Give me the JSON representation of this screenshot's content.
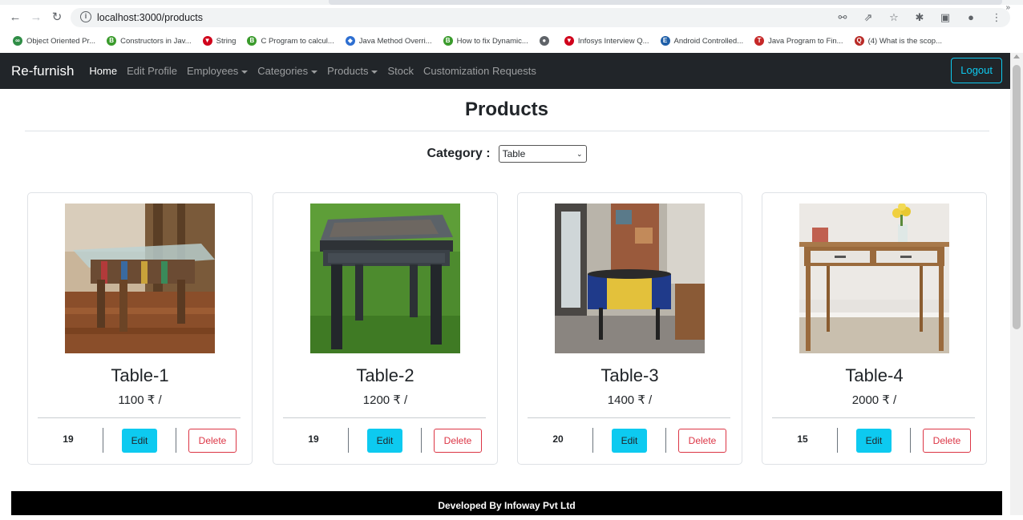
{
  "browser": {
    "url": "localhost:3000/products",
    "bookmarks": [
      {
        "label": "Object Oriented Pr...",
        "icon": "geeksforgeeks-icon",
        "color": "#2f8d46",
        "glyph": "∞"
      },
      {
        "label": "Constructors in Jav...",
        "icon": "b-logo-icon",
        "color": "#3a9b2c",
        "glyph": "B"
      },
      {
        "label": "String",
        "icon": "vue-logo-icon",
        "color": "#d0021b",
        "glyph": "▼"
      },
      {
        "label": "C Program to calcul...",
        "icon": "b-logo-icon",
        "color": "#3a9b2c",
        "glyph": "B"
      },
      {
        "label": "Java Method Overri...",
        "icon": "diamond-logo-icon",
        "color": "#2e6fd1",
        "glyph": "◆"
      },
      {
        "label": "How to fix Dynamic...",
        "icon": "b-logo-icon",
        "color": "#3a9b2c",
        "glyph": "B"
      },
      {
        "label": "",
        "icon": "globe-icon",
        "color": "#5f6368",
        "glyph": "●"
      },
      {
        "label": "Infosys Interview Q...",
        "icon": "vue-logo-icon",
        "color": "#d0021b",
        "glyph": "▼"
      },
      {
        "label": "Android Controlled...",
        "icon": "e-logo-icon",
        "color": "#1f5fa8",
        "glyph": "E"
      },
      {
        "label": "Java Program to Fin...",
        "icon": "tg-logo-icon",
        "color": "#c62828",
        "glyph": "T"
      },
      {
        "label": "(4) What is the scop...",
        "icon": "quora-icon",
        "color": "#b92b27",
        "glyph": "Q"
      }
    ]
  },
  "nav": {
    "brand": "Re-furnish",
    "links": [
      {
        "label": "Home",
        "active": true,
        "dropdown": false
      },
      {
        "label": "Edit Profile",
        "active": false,
        "dropdown": false
      },
      {
        "label": "Employees",
        "active": false,
        "dropdown": true
      },
      {
        "label": "Categories",
        "active": false,
        "dropdown": true
      },
      {
        "label": "Products",
        "active": false,
        "dropdown": true
      },
      {
        "label": "Stock",
        "active": false,
        "dropdown": false
      },
      {
        "label": "Customization Requests",
        "active": false,
        "dropdown": false
      }
    ],
    "logout_label": "Logout"
  },
  "page": {
    "title": "Products",
    "category_label": "Category :",
    "category_selected": "Table"
  },
  "products": [
    {
      "name": "Table-1",
      "price": "1100 ₹ /",
      "stock": "19",
      "edit_label": "Edit",
      "delete_label": "Delete",
      "image": "glass-top-table"
    },
    {
      "name": "Table-2",
      "price": "1200 ₹ /",
      "stock": "19",
      "edit_label": "Edit",
      "delete_label": "Delete",
      "image": "carved-dark-table"
    },
    {
      "name": "Table-3",
      "price": "1400 ₹ /",
      "stock": "20",
      "edit_label": "Edit",
      "delete_label": "Delete",
      "image": "barrel-table"
    },
    {
      "name": "Table-4",
      "price": "2000 ₹ /",
      "stock": "15",
      "edit_label": "Edit",
      "delete_label": "Delete",
      "image": "console-table"
    }
  ],
  "footer": {
    "text": "Developed By Infoway Pvt Ltd"
  },
  "colors": {
    "navbar": "#212529",
    "accent": "#0dcaf0",
    "danger": "#dc3545",
    "footer": "#000000"
  }
}
